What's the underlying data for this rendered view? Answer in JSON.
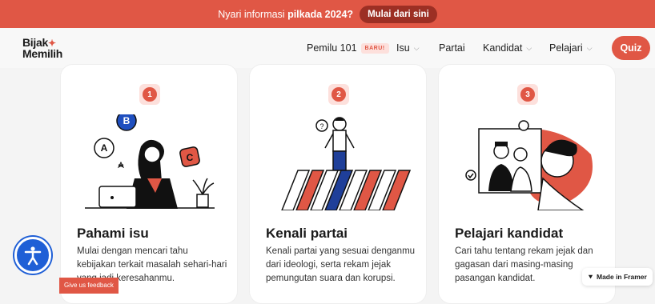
{
  "banner": {
    "prefix": "Nyari informasi",
    "highlight": "pilkada 2024?",
    "cta": "Mulai dari sini"
  },
  "logo": {
    "line1": "Bijak",
    "line2": "Memilih"
  },
  "nav": {
    "items": [
      {
        "label": "Pemilu 101",
        "badge": "BARU!"
      },
      {
        "label": "Isu",
        "dropdown": true
      },
      {
        "label": "Partai"
      },
      {
        "label": "Kandidat",
        "dropdown": true
      },
      {
        "label": "Pelajari",
        "dropdown": true
      }
    ],
    "quiz": "Quiz"
  },
  "cards": [
    {
      "number": "1",
      "title": "Pahami isu",
      "desc": "Mulai dengan mencari tahu kebijakan terkait masalah sehari-hari yang jadi keresahanmu."
    },
    {
      "number": "2",
      "title": "Kenali partai",
      "desc": "Kenali partai yang sesuai denganmu dari ideologi, serta rekam jejak pemungutan suara dan korupsi."
    },
    {
      "number": "3",
      "title": "Pelajari kandidat",
      "desc": "Cari tahu tentang rekam jejak dan gagasan dari masing-masing pasangan kandidat."
    }
  ],
  "illustration_letters": [
    "A",
    "B",
    "C"
  ],
  "feedback": "Give us feedback",
  "framer": "Made in Framer",
  "colors": {
    "accent": "#e05745",
    "accent_dark": "#9c2f24",
    "accessibility": "#1f5fd6"
  }
}
